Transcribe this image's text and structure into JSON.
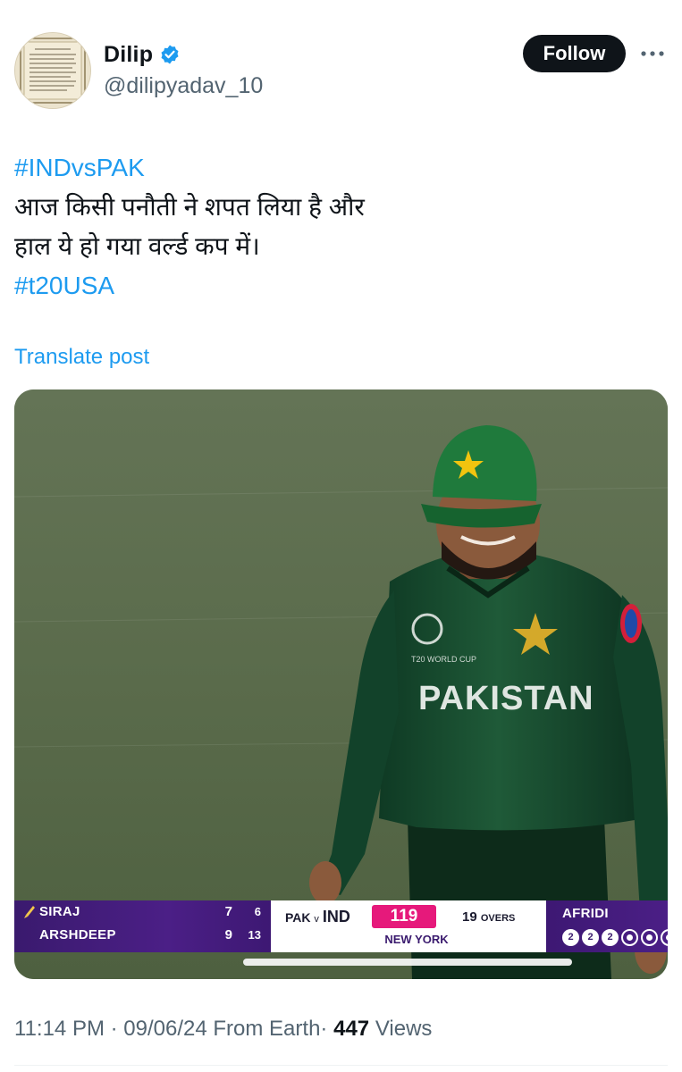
{
  "author": {
    "display_name": "Dilip",
    "handle": "@dilipyadav_10",
    "verified": true,
    "avatar": "document-scroll-avatar",
    "follow_label": "Follow",
    "more_icon": "more-horizontal-icon"
  },
  "post": {
    "lines": [
      {
        "text": "#INDvsPAK",
        "hashtag": true
      },
      {
        "text": "आज किसी पनौती ने शपत लिया है और",
        "hashtag": false
      },
      {
        "text": "हाल ये हो गया वर्ल्ड कप में।",
        "hashtag": false
      },
      {
        "text": "#t20USA",
        "hashtag": true
      }
    ],
    "translate_label": "Translate post"
  },
  "media": {
    "jersey_text": "PAKISTAN",
    "scoreboard": {
      "batters": [
        {
          "name": "SIRAJ",
          "runs": "7",
          "balls": "6",
          "on_strike": true
        },
        {
          "name": "ARSHDEEP",
          "runs": "9",
          "balls": "13",
          "on_strike": false
        }
      ],
      "match_prefix": "PAK",
      "match_vs": "v",
      "batting_team": "IND",
      "score": "119",
      "overs": "19",
      "overs_unit": "OVERS",
      "venue": "NEW YORK",
      "bowler": "AFRIDI",
      "balls_this_over": [
        "2",
        "2",
        "2",
        "•",
        "•",
        "•"
      ]
    }
  },
  "meta": {
    "time": "11:14 PM",
    "separator": "·",
    "date": "09/06/24",
    "source": "From Earth",
    "views_count": "447",
    "views_label": "Views"
  },
  "colors": {
    "link": "#1d9bf0",
    "verified": "#1d9bf0",
    "follow_bg": "#0f1419",
    "score_pink": "#e6197b",
    "scoreboard_purple": "#4b1f86"
  }
}
